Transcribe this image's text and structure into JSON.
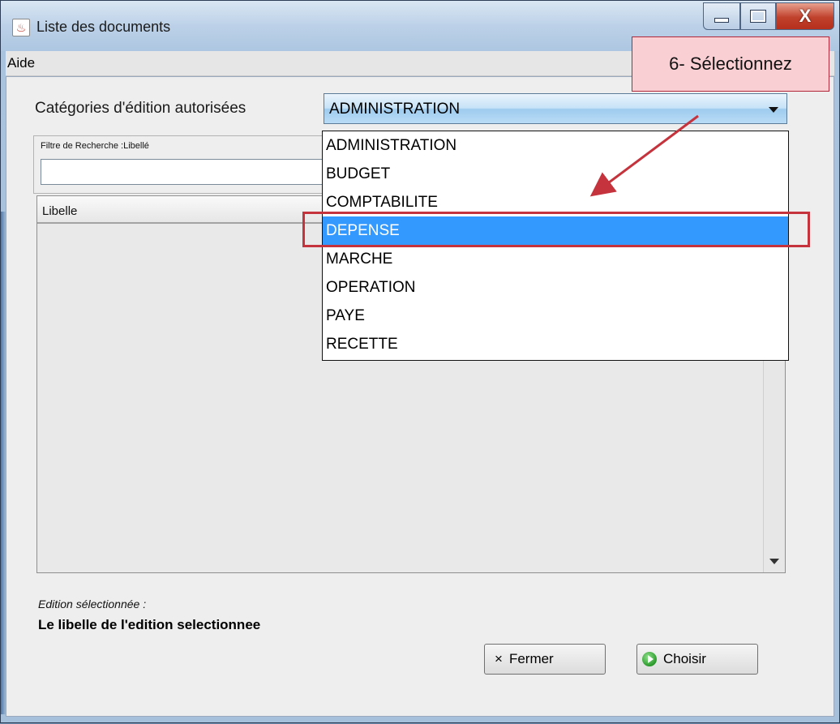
{
  "window": {
    "title": "Liste des documents",
    "close_glyph": "X"
  },
  "menu": {
    "items": [
      "Aide"
    ]
  },
  "category": {
    "label": "Catégories d'édition autorisées",
    "selected": "ADMINISTRATION",
    "options": [
      "ADMINISTRATION",
      "BUDGET",
      "COMPTABILITE",
      "DEPENSE",
      "MARCHE",
      "OPERATION",
      "PAYE",
      "RECETTE"
    ],
    "highlighted_option": "DEPENSE"
  },
  "filter": {
    "label": "Filtre de Recherche :Libellé",
    "value": ""
  },
  "table": {
    "columns": [
      "Libelle"
    ]
  },
  "selection": {
    "caption": "Edition sélectionnée :",
    "value": "Le libelle de l'edition selectionnee"
  },
  "buttons": {
    "fermer": "Fermer",
    "choisir": "Choisir"
  },
  "annotation": {
    "text": "6-   Sélectionnez",
    "color": "#c5333d"
  },
  "colors": {
    "selection_blue": "#3399ff",
    "annotation_fill": "#f9cfd4"
  }
}
